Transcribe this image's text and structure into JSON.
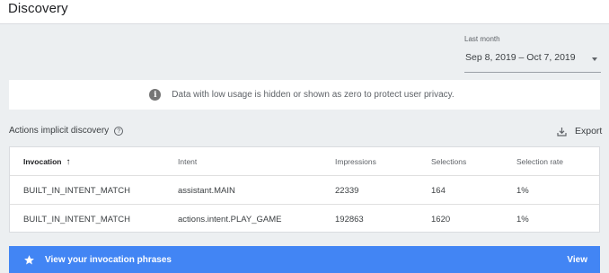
{
  "header": {
    "title": "Discovery"
  },
  "date_range": {
    "label": "Last month",
    "value": "Sep 8, 2019 – Oct 7, 2019",
    "icon": "dropdown-arrow-icon"
  },
  "privacy_notice": {
    "icon": "info-icon",
    "text": "Data with low usage is hidden or shown as zero to protect user privacy."
  },
  "section": {
    "title": "Actions implicit discovery",
    "help_icon": "?",
    "export_label": "Export"
  },
  "table": {
    "headers": [
      "Invocation",
      "Intent",
      "Impressions",
      "Selections",
      "Selection rate"
    ],
    "sort_indicator": "↑",
    "rows": [
      [
        "BUILT_IN_INTENT_MATCH",
        "assistant.MAIN",
        "22339",
        "164",
        "1%"
      ],
      [
        "BUILT_IN_INTENT_MATCH",
        "actions.intent.PLAY_GAME",
        "192863",
        "1620",
        "1%"
      ]
    ]
  },
  "cta": {
    "icon": "star-icon",
    "label": "View your invocation phrases",
    "action_label": "View"
  },
  "colors": {
    "accent": "#4285f4",
    "background": "#eceff1"
  }
}
